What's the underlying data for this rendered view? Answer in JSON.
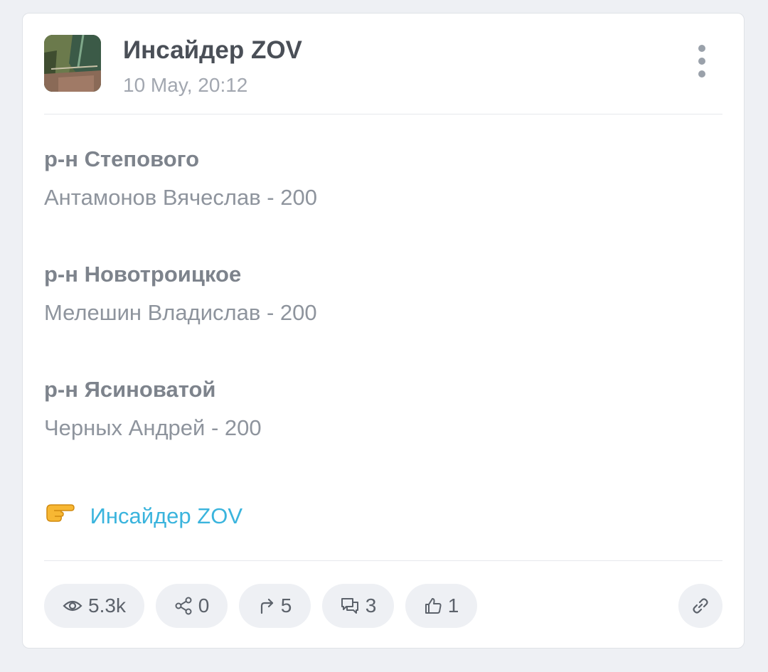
{
  "channel": {
    "name": "Инсайдер ZOV",
    "date": "10 May, 20:12"
  },
  "post": {
    "blocks": [
      {
        "region": "р-н Степового",
        "entry": "Антамонов Вячеслав - 200"
      },
      {
        "region": "р-н Новотроицкое",
        "entry": "Мелешин Владислав - 200"
      },
      {
        "region": "р-н Ясиноватой",
        "entry": "Черных Андрей - 200"
      }
    ],
    "signature_link": "Инсайдер ZOV"
  },
  "stats": {
    "views": "5.3k",
    "shares": "0",
    "forwards": "5",
    "comments": "3",
    "likes": "1"
  },
  "colors": {
    "link": "#3ab4dd",
    "background": "#eef0f4"
  },
  "icons": {
    "menu": "more-vertical-icon",
    "views": "eye-icon",
    "shares": "share-icon",
    "forwards": "forward-arrow-icon",
    "comments": "comments-icon",
    "likes": "thumbs-up-icon",
    "copy_link": "link-icon",
    "pointer": "pointing-hand-emoji"
  }
}
